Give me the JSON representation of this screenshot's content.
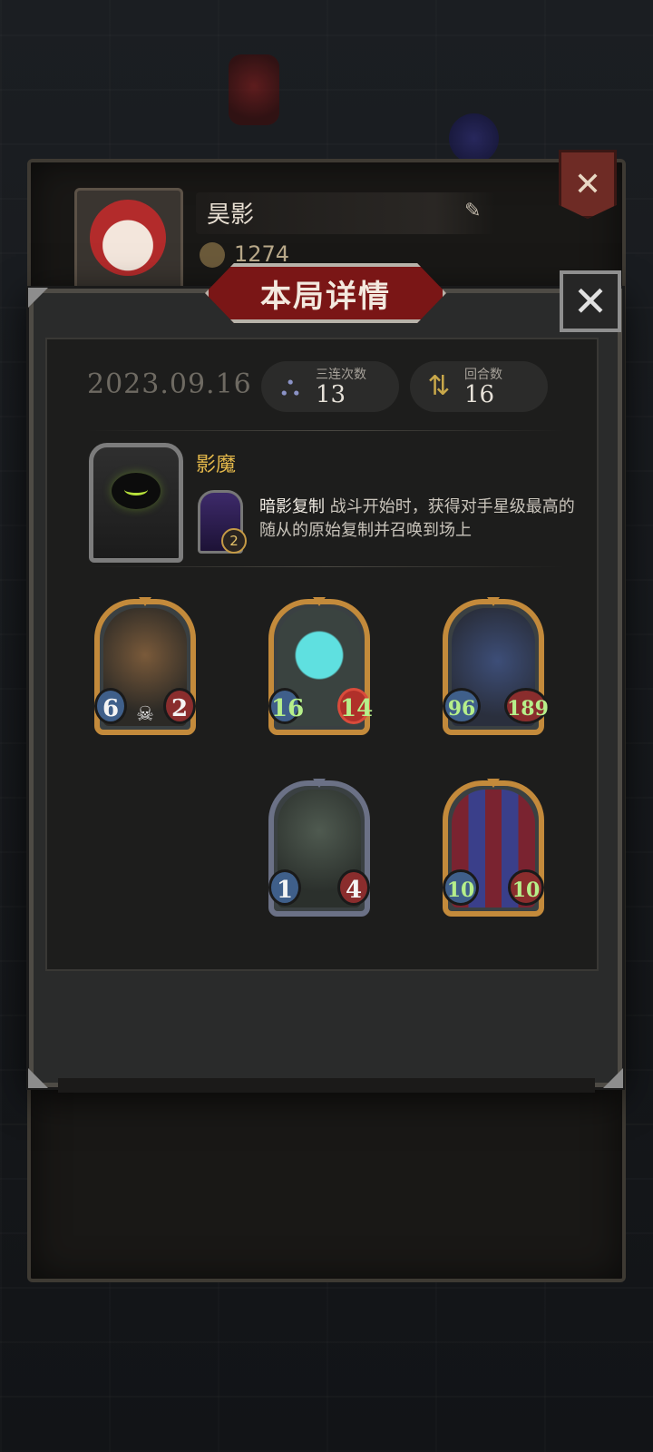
{
  "background": {
    "player_name": "昊影",
    "score": "1274",
    "edit_icon": "pencil-icon",
    "close_banner_icon": "close-icon"
  },
  "modal": {
    "title": "本局详情",
    "close_icon": "close-icon",
    "date": "2023.09.16",
    "stats": [
      {
        "label": "三连次数",
        "value": "13",
        "icon": "triple-merge-icon"
      },
      {
        "label": "回合数",
        "value": "16",
        "icon": "turn-cycle-icon"
      }
    ],
    "hero": {
      "name": "影魔",
      "ability_name": "暗影复制",
      "ability_desc": " 战斗开始时，获得对手星级最高的随从的原始复制并召唤到场上",
      "ability_level": "2"
    },
    "minions": [
      {
        "attack": "6",
        "health": "2",
        "frame": "gold",
        "art": "chest-tentacle-monster",
        "deathrattle": true,
        "atk_buffed": false,
        "hp_buffed": false,
        "hp_star": false
      },
      {
        "attack": "16",
        "health": "14",
        "frame": "gold",
        "art": "cyan-ghost",
        "deathrattle": false,
        "atk_buffed": true,
        "hp_buffed": true,
        "hp_star": true
      },
      {
        "attack": "96",
        "health": "189",
        "frame": "gold",
        "art": "pirate-captain",
        "deathrattle": false,
        "atk_buffed": true,
        "hp_buffed": true,
        "hp_star": false
      },
      {
        "attack": "1",
        "health": "4",
        "frame": "silver",
        "art": "skull-reaper",
        "deathrattle": false,
        "atk_buffed": false,
        "hp_buffed": false,
        "hp_star": false
      },
      {
        "attack": "10",
        "health": "10",
        "frame": "gold",
        "art": "jester-clown",
        "deathrattle": false,
        "atk_buffed": true,
        "hp_buffed": true,
        "hp_star": false
      }
    ]
  },
  "colors": {
    "gold_frame": "#c38a3b",
    "buff_text": "#b6ef8a",
    "title_red": "#7a1616",
    "hero_name": "#e1b64a"
  }
}
